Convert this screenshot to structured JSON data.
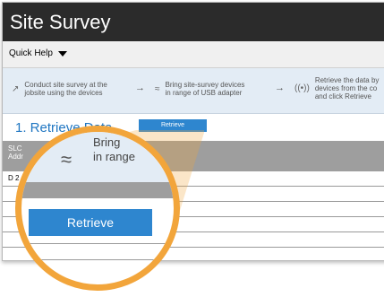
{
  "window": {
    "title": "Site Survey"
  },
  "menu": {
    "quick_help": "Quick Help"
  },
  "steps": [
    {
      "text_line1": "Conduct site survey at the",
      "text_line2": "jobsite using the devices",
      "icon": "sensor-icon"
    },
    {
      "text_line1": "Bring site-survey devices",
      "text_line2": "in range of USB adapter",
      "icon": "wifi-icon"
    },
    {
      "text_line1": "Retrieve the data by",
      "text_line2": "devices from the co",
      "text_line3": "and click Retrieve",
      "icon": "broadcast-icon"
    }
  ],
  "section": {
    "title": "1. Retrieve Data",
    "retrieve_label": "Retrieve"
  },
  "table": {
    "header_line1": "SLC",
    "header_line2": "Addr",
    "rows": [
      "D 2",
      "",
      "",
      "",
      ""
    ]
  },
  "magnifier": {
    "bring_line1": "Bring",
    "bring_line2": "in range",
    "retrieve_label": "Retrieve"
  },
  "colors": {
    "accent": "#2e86cf",
    "highlight": "#f2a53b",
    "titlebar": "#2b2b2b"
  }
}
